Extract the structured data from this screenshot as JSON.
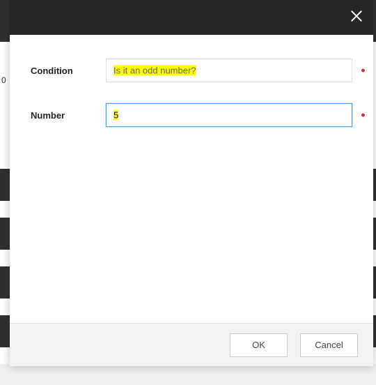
{
  "background": {
    "side_text": "0"
  },
  "modal": {
    "close_label": "Close",
    "fields": {
      "condition": {
        "label": "Condition",
        "value": "Is it an odd number?",
        "required": true
      },
      "number": {
        "label": "Number",
        "value": "5",
        "required": true
      }
    },
    "footer": {
      "ok_label": "OK",
      "cancel_label": "Cancel"
    }
  },
  "colors": {
    "header_bg": "#262626",
    "accent": "#4a9ee8",
    "required": "#d9342b",
    "highlight": "#ffff00"
  }
}
